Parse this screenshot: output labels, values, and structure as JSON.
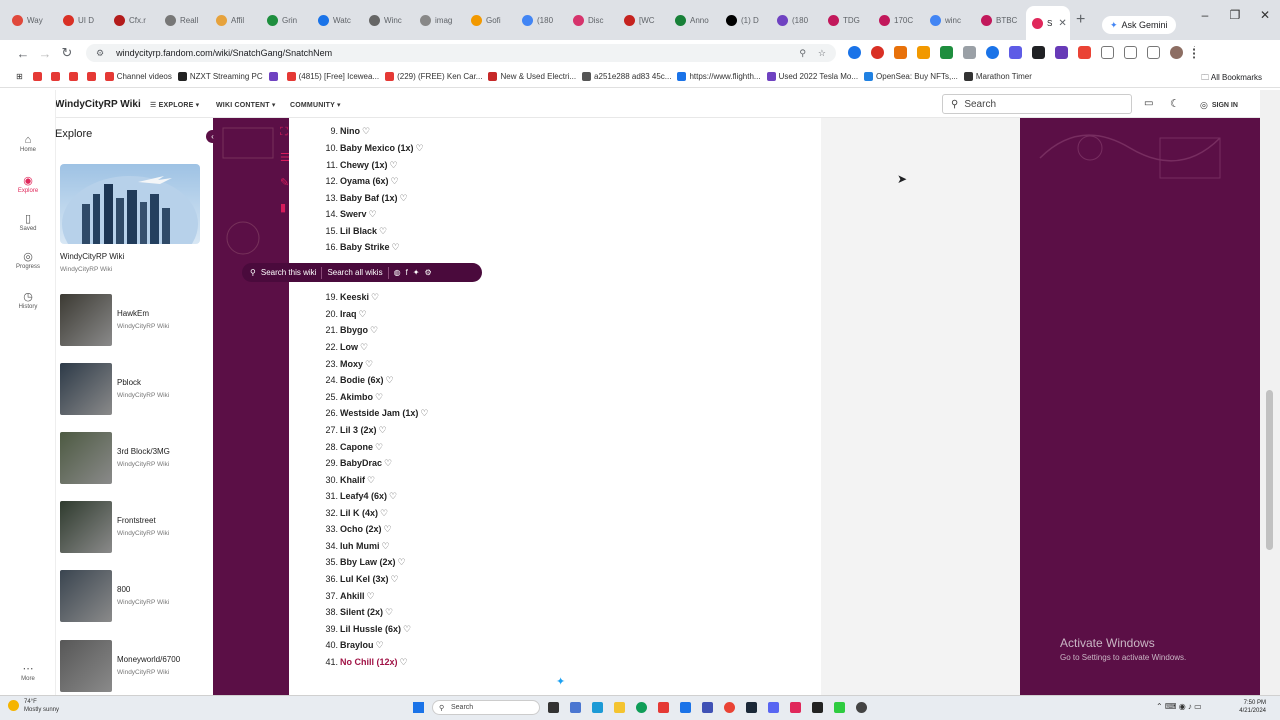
{
  "browser": {
    "tabs": [
      {
        "label": "Way",
        "color": "#e0483b"
      },
      {
        "label": "UI D",
        "color": "#d93025"
      },
      {
        "label": "Cfx.r",
        "color": "#b31b1b"
      },
      {
        "label": "Reall",
        "color": "#777777"
      },
      {
        "label": "Affil",
        "color": "#e6a23c"
      },
      {
        "label": "Grin",
        "color": "#1e8e3e"
      },
      {
        "label": "Watc",
        "color": "#1a73e8"
      },
      {
        "label": "Winc",
        "color": "#666666"
      },
      {
        "label": "imag",
        "color": "#888888"
      },
      {
        "label": "Gofi",
        "color": "#f29900"
      },
      {
        "label": "(180",
        "color": "#4285f4"
      },
      {
        "label": "Disc",
        "color": "#d6336c"
      },
      {
        "label": "[WC",
        "color": "#c5221f"
      },
      {
        "label": "Anno",
        "color": "#188038"
      },
      {
        "label": "(1) D",
        "color": "#000000"
      },
      {
        "label": "(180",
        "color": "#6f42c1"
      },
      {
        "label": "TDG",
        "color": "#c2185b"
      },
      {
        "label": "170C",
        "color": "#c2185b"
      },
      {
        "label": "winc",
        "color": "#4285f4"
      },
      {
        "label": "BTBC",
        "color": "#c2185b"
      },
      {
        "label": "S",
        "color": "#e0285b",
        "active": true
      }
    ],
    "gemini_label": "Ask Gemini",
    "url": "windycityrp.fandom.com/wiki/SnatchGang/SnatchNem",
    "bookmarks": [
      {
        "label": "",
        "color": "#e53935"
      },
      {
        "label": "",
        "color": "#e53935"
      },
      {
        "label": "",
        "color": "#e53935"
      },
      {
        "label": "",
        "color": "#e53935"
      },
      {
        "label": "Channel videos",
        "color": "#e53935"
      },
      {
        "label": "NZXT Streaming PC",
        "color": "#222222"
      },
      {
        "label": "",
        "color": "#6f42c1"
      },
      {
        "label": "(4815) [Free] Icewea...",
        "color": "#e53935"
      },
      {
        "label": "(229) (FREE) Ken Car...",
        "color": "#e53935"
      },
      {
        "label": "New & Used Electri...",
        "color": "#c62828"
      },
      {
        "label": "a251e288 ad83 45c...",
        "color": "#555555"
      },
      {
        "label": "https://www.flighth...",
        "color": "#1a73e8"
      },
      {
        "label": "Used 2022 Tesla Mo...",
        "color": "#6f42c1"
      },
      {
        "label": "OpenSea: Buy NFTs,...",
        "color": "#2081e2"
      },
      {
        "label": "Marathon Timer",
        "color": "#333333"
      }
    ],
    "all_bookmarks": "All Bookmarks"
  },
  "fandom": {
    "wiki_name": "WindyCityRP Wiki",
    "menus": [
      "EXPLORE",
      "WIKI CONTENT",
      "COMMUNITY"
    ],
    "search_placeholder": "Search",
    "sign_in": "SIGN IN",
    "rail": [
      "Home",
      "Explore",
      "Saved",
      "Progress",
      "History",
      "More"
    ],
    "explore_title": "Explore",
    "featured": {
      "name": "WindyCityRP Wiki",
      "sub": "WindyCityRP Wiki"
    },
    "cards": [
      {
        "name": "HawkEm",
        "sub": "WindyCityRP Wiki",
        "color": "#3c3a33"
      },
      {
        "name": "Pblock",
        "sub": "WindyCityRP Wiki",
        "color": "#2d3a48"
      },
      {
        "name": "3rd Block/3MG",
        "sub": "WindyCityRP Wiki",
        "color": "#4d5a42"
      },
      {
        "name": "Frontstreet",
        "sub": "WindyCityRP Wiki",
        "color": "#2f3b2e"
      },
      {
        "name": "800",
        "sub": "WindyCityRP Wiki",
        "color": "#3a4550"
      },
      {
        "name": "Moneyworld/6700",
        "sub": "WindyCityRP Wiki",
        "color": "#575757"
      }
    ],
    "search_bar": {
      "this_wiki": "Search this wiki",
      "all_wikis": "Search all wikis"
    }
  },
  "list": [
    {
      "n": "9.",
      "name": "Nino",
      "suffix": ""
    },
    {
      "n": "10.",
      "name": "Baby Mexico (1x)",
      "suffix": ""
    },
    {
      "n": "11.",
      "name": "Chewy (1x)",
      "suffix": ""
    },
    {
      "n": "12.",
      "name": "Oyama (6x)",
      "suffix": ""
    },
    {
      "n": "13.",
      "name": "Baby Baf (1x)",
      "suffix": ""
    },
    {
      "n": "14.",
      "name": "Swerv",
      "suffix": ""
    },
    {
      "n": "15.",
      "name": "Lil Black",
      "suffix": ""
    },
    {
      "n": "16.",
      "name": "Baby Strike",
      "suffix": ""
    },
    {
      "n": "19.",
      "name": "Keeski",
      "suffix": ""
    },
    {
      "n": "20.",
      "name": "Iraq",
      "suffix": ""
    },
    {
      "n": "21.",
      "name": "Bbygo",
      "suffix": ""
    },
    {
      "n": "22.",
      "name": "Low",
      "suffix": ""
    },
    {
      "n": "23.",
      "name": "Moxy",
      "suffix": ""
    },
    {
      "n": "24.",
      "name": "Bodie (6x)",
      "suffix": ""
    },
    {
      "n": "25.",
      "name": "Akimbo",
      "suffix": ""
    },
    {
      "n": "26.",
      "name": "Westside Jam (1x)",
      "suffix": ""
    },
    {
      "n": "27.",
      "name": "Lil 3 (2x)",
      "suffix": ""
    },
    {
      "n": "28.",
      "name": "Capone",
      "suffix": ""
    },
    {
      "n": "29.",
      "name": "BabyDrac",
      "suffix": ""
    },
    {
      "n": "30.",
      "name": "Khalif",
      "suffix": ""
    },
    {
      "n": "31.",
      "name": "Leafy4 (6x)",
      "suffix": ""
    },
    {
      "n": "32.",
      "name": "Lil K (4x)",
      "suffix": ""
    },
    {
      "n": "33.",
      "name": "Ocho (2x)",
      "suffix": ""
    },
    {
      "n": "34.",
      "name": "Iuh Mumi",
      "suffix": ""
    },
    {
      "n": "35.",
      "name": "Bby Law (2x)",
      "suffix": ""
    },
    {
      "n": "36.",
      "name": "Lul Kel (3x)",
      "suffix": ""
    },
    {
      "n": "37.",
      "name": "Ahkill",
      "suffix": ""
    },
    {
      "n": "38.",
      "name": "Silent (2x)",
      "suffix": ""
    },
    {
      "n": "39.",
      "name": "Lil Hussle (6x)",
      "suffix": ""
    },
    {
      "n": "40.",
      "name": "Braylou",
      "suffix": ""
    },
    {
      "n": "41.",
      "name": "No Chill (12x)",
      "suffix": "",
      "link": true
    }
  ],
  "watermark": {
    "line1": "Activate Windows",
    "line2": "Go to Settings to activate Windows."
  },
  "taskbar": {
    "weather_temp": "74°F",
    "weather_desc": "Mostly sunny",
    "search": "Search",
    "time": "7:50 PM",
    "date": "4/21/2024"
  }
}
